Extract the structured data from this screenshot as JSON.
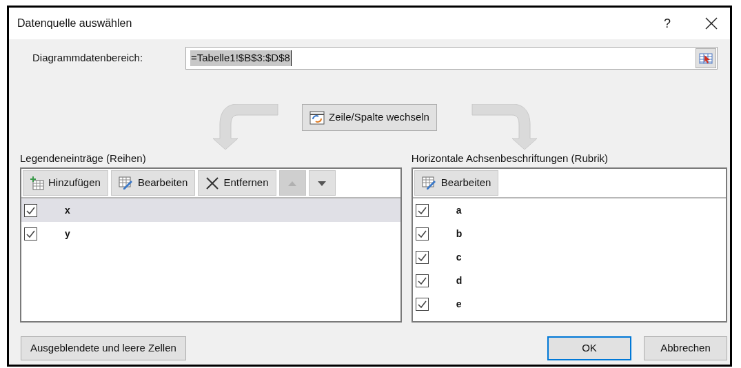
{
  "window": {
    "title": "Datenquelle auswählen",
    "help": "?"
  },
  "range": {
    "label": "Diagrammdatenbereich:",
    "value": "=Tabelle1!$B$3:$D$8"
  },
  "swap_button": "Zeile/Spalte wechseln",
  "series_panel": {
    "title": "Legendeneinträge (Reihen)",
    "toolbar": [
      {
        "kind": "add",
        "label": "Hinzufügen",
        "disabled": false
      },
      {
        "kind": "edit",
        "label": "Bearbeiten",
        "disabled": false
      },
      {
        "kind": "remove",
        "label": "Entfernen",
        "disabled": false
      },
      {
        "kind": "up",
        "disabled": true
      },
      {
        "kind": "down",
        "disabled": false
      }
    ],
    "items": [
      {
        "label": "x",
        "checked": true,
        "selected": true
      },
      {
        "label": "y",
        "checked": true,
        "selected": false
      }
    ]
  },
  "category_panel": {
    "title": "Horizontale Achsenbeschriftungen (Rubrik)",
    "toolbar": [
      {
        "kind": "edit",
        "label": "Bearbeiten",
        "disabled": false
      }
    ],
    "items": [
      {
        "label": "a",
        "checked": true,
        "selected": false
      },
      {
        "label": "b",
        "checked": true,
        "selected": false
      },
      {
        "label": "c",
        "checked": true,
        "selected": false
      },
      {
        "label": "d",
        "checked": true,
        "selected": false
      },
      {
        "label": "e",
        "checked": true,
        "selected": false
      }
    ]
  },
  "footer": {
    "hidden_cells_button": "Ausgeblendete und leere Zellen",
    "ok_button": "OK",
    "cancel_button": "Abbrechen"
  }
}
